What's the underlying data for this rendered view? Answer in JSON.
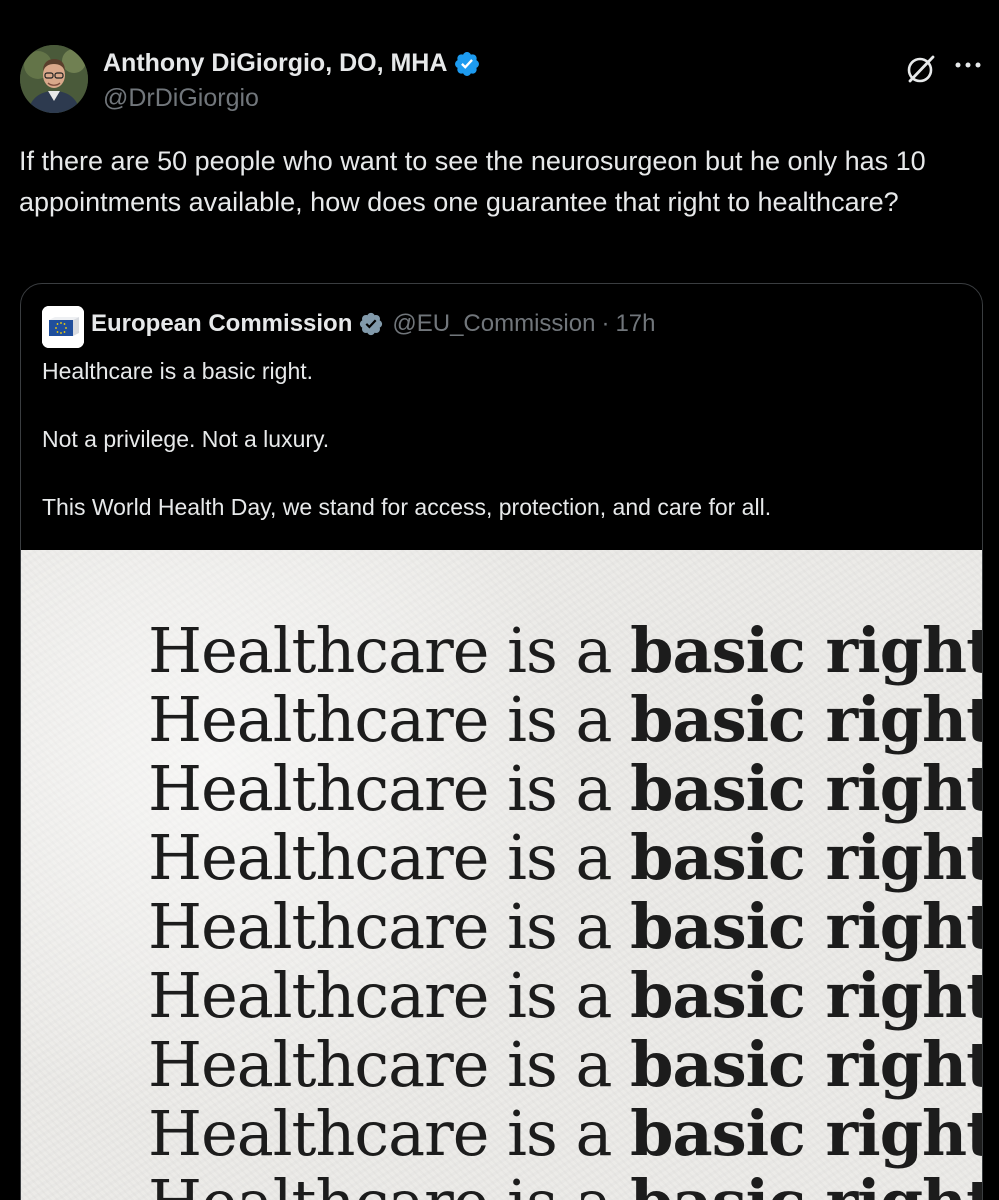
{
  "post": {
    "author": {
      "name": "Anthony DiGiorgio, DO, MHA",
      "handle": "@DrDiGiorgio",
      "verified": true,
      "verified_color": "#1d9bf0"
    },
    "text": "If there are 50 people who want to see the neurosurgeon but he only has 10 appointments available, how does one guarantee that right to healthcare?",
    "actions": {
      "grok_icon": "grok-icon",
      "more_icon": "more-icon"
    }
  },
  "quote": {
    "author": {
      "name": "European Commission",
      "handle": "@EU_Commission",
      "separator": "·",
      "time": "17h",
      "badge": "gray-verified-badge",
      "badge_color": "#829aab"
    },
    "paragraphs": [
      "Healthcare is a basic right.",
      "Not a privilege. Not a luxury.",
      "This World Health Day, we stand for access, protection, and care for all."
    ],
    "image": {
      "line_light": "Healthcare is a",
      "line_bold": "basic right.",
      "repeat_lines": [
        {
          "light": "Healthcare is a",
          "bold": "basic right."
        },
        {
          "light": "Healthcare is a",
          "bold": "basic right."
        },
        {
          "light": "Healthcare is a",
          "bold": "basic right."
        },
        {
          "light": "Healthcare is a",
          "bold": "basic right."
        },
        {
          "light": "Healthcare is a",
          "bold": "basic right."
        },
        {
          "light": "Healthcare is a",
          "bold": "basic right."
        },
        {
          "light": "Healthcare is a",
          "bold": "basic right."
        },
        {
          "light": "Healthcare is a",
          "bold": "basic right."
        },
        {
          "light": "Healthcare is a",
          "bold": "basic right."
        }
      ]
    }
  },
  "colors": {
    "background": "#000000",
    "text": "#e7e9ea",
    "secondary_text": "#71767b",
    "border": "#3a3d40"
  }
}
